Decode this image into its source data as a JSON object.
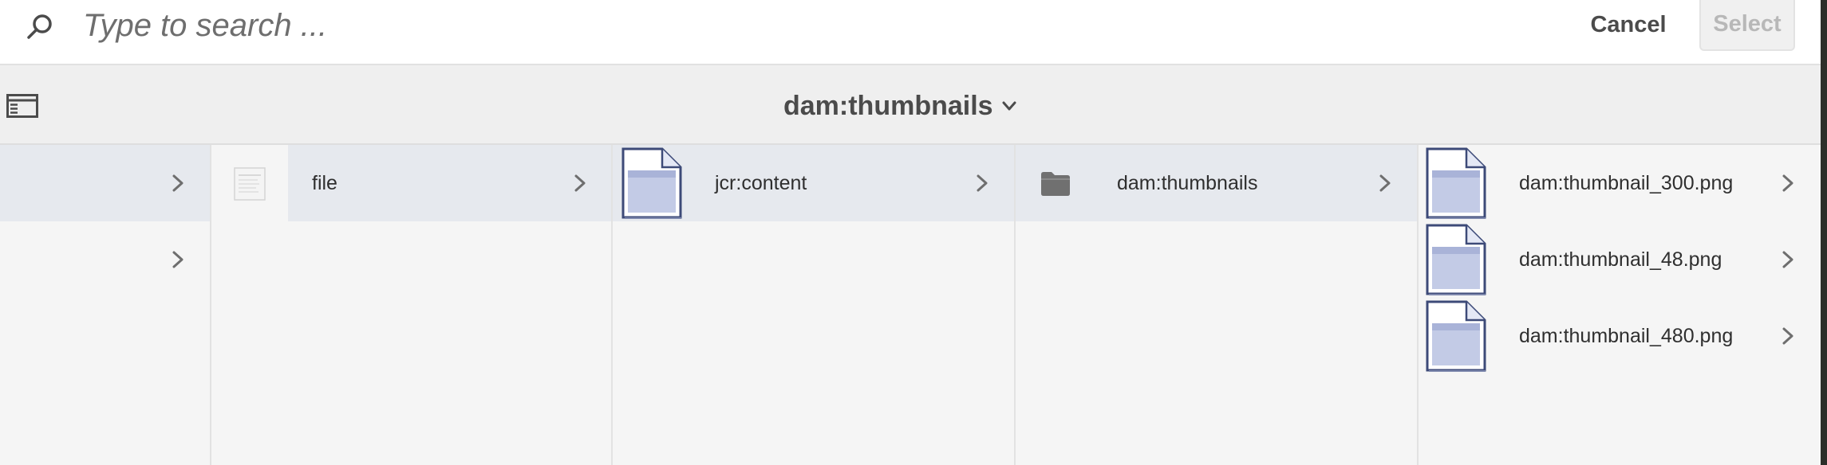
{
  "search": {
    "placeholder": "Type to search ...",
    "value": "",
    "cancel_label": "Cancel",
    "select_label": "Select"
  },
  "header": {
    "title": "dam:thumbnails"
  },
  "columns": [
    {
      "items": [
        {
          "label": "",
          "active": true
        },
        {
          "label": "",
          "active": false
        }
      ]
    },
    {
      "items": [
        {
          "label": "file",
          "active": true,
          "icon": "file-thumbnail-icon"
        }
      ]
    },
    {
      "items": [
        {
          "label": "jcr:content",
          "active": true,
          "icon": "document-icon"
        }
      ]
    },
    {
      "items": [
        {
          "label": "dam:thumbnails",
          "active": true,
          "icon": "folder-icon"
        }
      ]
    },
    {
      "items": [
        {
          "label": "dam:thumbnail_300.png",
          "active": false,
          "icon": "document-icon"
        },
        {
          "label": "dam:thumbnail_48.png",
          "active": false,
          "icon": "document-icon"
        },
        {
          "label": "dam:thumbnail_480.png",
          "active": false,
          "icon": "document-icon"
        }
      ]
    }
  ],
  "colors": {
    "active_row": "#e6e9ee",
    "background": "#f5f5f5",
    "header_bg": "#efefef",
    "doc_icon_fill": "#c3cbe6",
    "doc_icon_border": "#3d4a78"
  }
}
